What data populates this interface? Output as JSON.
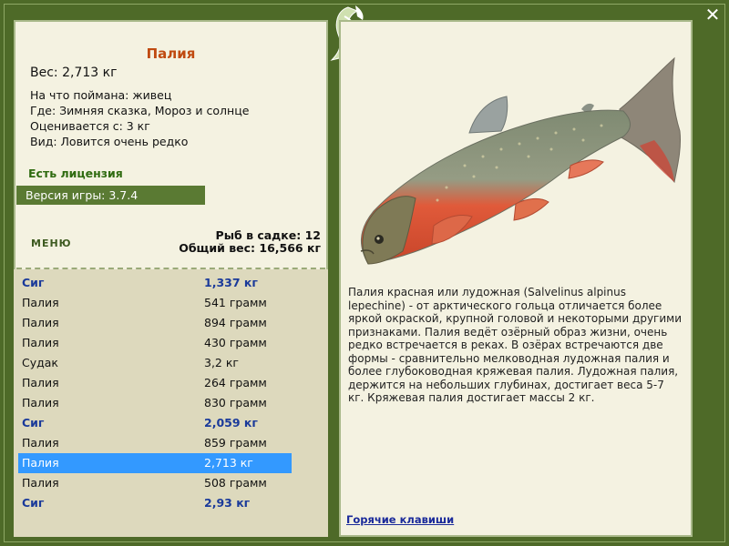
{
  "fish": {
    "name": "Палия",
    "weight": "Вес: 2,713 кг",
    "bait": "На что поймана: живец",
    "location": "Где: Зимняя сказка, Мороз и солнце",
    "valued_from": "Оценивается с: 3 кг",
    "kind": "Вид: Ловится очень редко"
  },
  "license": "Есть лицензия",
  "version": "Версия игры: 3.7.4",
  "menu_label": "МЕНЮ",
  "cage": {
    "count": "Рыб в садке: 12",
    "total": "Общий вес: 16,566 кг"
  },
  "catch_list": [
    {
      "name": "Сиг",
      "weight": "1,337 кг",
      "bold": true
    },
    {
      "name": "Палия",
      "weight": "541 грамм"
    },
    {
      "name": "Палия",
      "weight": "894 грамм"
    },
    {
      "name": "Палия",
      "weight": "430 грамм"
    },
    {
      "name": "Судак",
      "weight": "3,2 кг"
    },
    {
      "name": "Палия",
      "weight": "264 грамм"
    },
    {
      "name": "Палия",
      "weight": "830 грамм"
    },
    {
      "name": "Сиг",
      "weight": "2,059 кг",
      "bold": true
    },
    {
      "name": "Палия",
      "weight": "859 грамм"
    },
    {
      "name": "Палия",
      "weight": "2,713 кг",
      "selected": true
    },
    {
      "name": "Палия",
      "weight": "508 грамм"
    },
    {
      "name": "Сиг",
      "weight": "2,93 кг",
      "bold": true
    }
  ],
  "description": "Палия красная или лудожная (Salvelinus alpinus lepechine) - от арктического гольца отличается более яркой окраской, крупной головой и некоторыми другими признаками. Палия ведёт озёрный образ жизни, очень редко встречается в реках. В озёрах встречаются две формы - сравнительно мелководная лудожная палия и более глубоководная кряжевая палия. Лудожная палия, держится на небольших глубинах, достигает веса 5-7 кг. Кряжевая палия достигает массы 2 кг.",
  "hotkeys_label": "Горячие клавиши",
  "close_icon": "close-icon",
  "colors": {
    "frame": "#4e6a28",
    "panel": "#f4f2e1",
    "list_bg": "#ddd9bd",
    "title": "#c04a10",
    "license": "#2f6b10",
    "selection": "#3399ff",
    "highlight_text": "#1a3a9a"
  }
}
